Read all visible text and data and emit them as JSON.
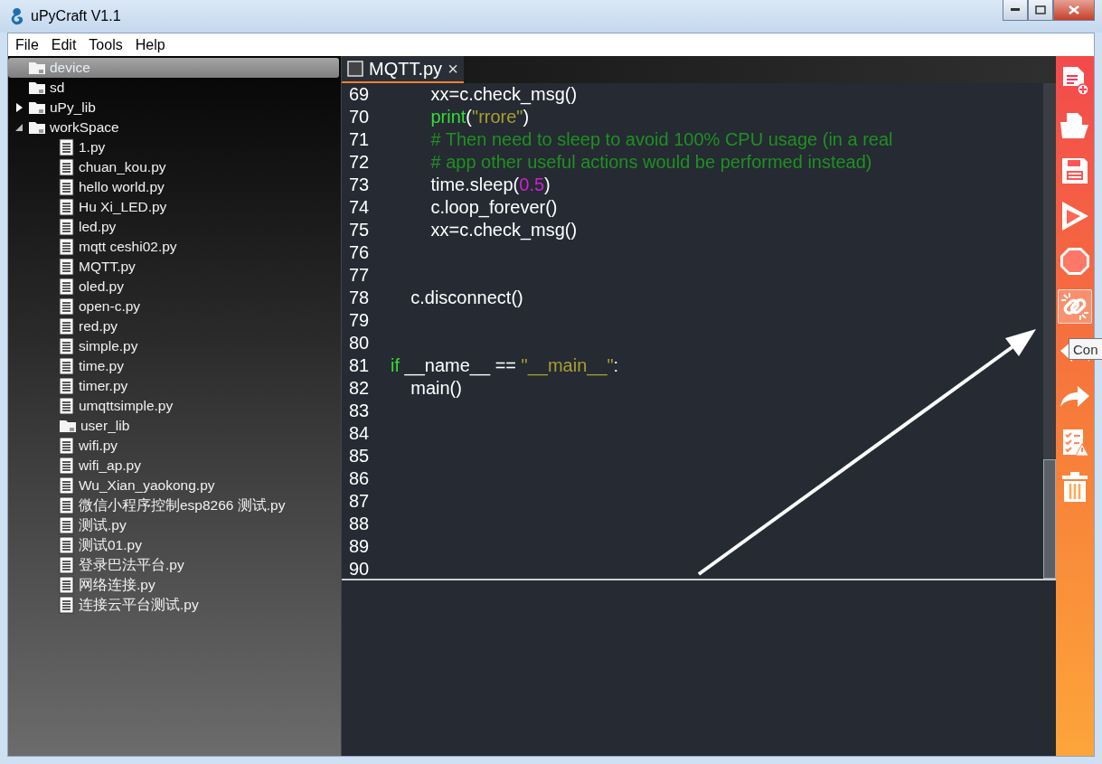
{
  "window": {
    "title": "uPyCraft V1.1"
  },
  "menu": [
    "File",
    "Edit",
    "Tools",
    "Help"
  ],
  "tree": [
    {
      "label": "device",
      "kind": "folder",
      "selected": true
    },
    {
      "label": "sd",
      "kind": "folder",
      "selected": false
    },
    {
      "label": "uPy_lib",
      "kind": "folder",
      "selected": false,
      "expanded": false
    },
    {
      "label": "workSpace",
      "kind": "folder",
      "selected": false,
      "expanded": true,
      "children": [
        {
          "label": "1.py",
          "kind": "file",
          "selected": false
        },
        {
          "label": "chuan_kou.py",
          "kind": "file",
          "selected": false
        },
        {
          "label": "hello world.py",
          "kind": "file",
          "selected": false
        },
        {
          "label": "Hu Xi_LED.py",
          "kind": "file",
          "selected": false
        },
        {
          "label": "led.py",
          "kind": "file",
          "selected": false
        },
        {
          "label": "mqtt ceshi02.py",
          "kind": "file",
          "selected": false
        },
        {
          "label": "MQTT.py",
          "kind": "file",
          "selected": false
        },
        {
          "label": "oled.py",
          "kind": "file",
          "selected": false
        },
        {
          "label": "open-c.py",
          "kind": "file",
          "selected": false
        },
        {
          "label": "red.py",
          "kind": "file",
          "selected": false
        },
        {
          "label": "simple.py",
          "kind": "file",
          "selected": false
        },
        {
          "label": "time.py",
          "kind": "file",
          "selected": false
        },
        {
          "label": "timer.py",
          "kind": "file",
          "selected": false
        },
        {
          "label": "umqttsimple.py",
          "kind": "file",
          "selected": false
        },
        {
          "label": "user_lib",
          "kind": "folder",
          "selected": false
        },
        {
          "label": "wifi.py",
          "kind": "file",
          "selected": false
        },
        {
          "label": "wifi_ap.py",
          "kind": "file",
          "selected": false
        },
        {
          "label": "Wu_Xian_yaokong.py",
          "kind": "file",
          "selected": false
        },
        {
          "label": "微信小程序控制esp8266 测试.py",
          "kind": "file",
          "selected": false
        },
        {
          "label": "测试.py",
          "kind": "file",
          "selected": false
        },
        {
          "label": "测试01.py",
          "kind": "file",
          "selected": false
        },
        {
          "label": "登录巴法平台.py",
          "kind": "file",
          "selected": false
        },
        {
          "label": "网络连接.py",
          "kind": "file",
          "selected": false
        },
        {
          "label": "连接云平台测试.py",
          "kind": "file",
          "selected": false
        }
      ]
    }
  ],
  "tabs": [
    {
      "label": "MQTT.py",
      "selected": true,
      "close": "×"
    }
  ],
  "code": [
    {
      "number": "69",
      "tokens": [
        {
          "kind": "plain",
          "text": "        xx=c.check_msg()"
        }
      ]
    },
    {
      "number": "70",
      "tokens": [
        {
          "kind": "keyword",
          "text": "        print"
        },
        {
          "kind": "plain",
          "text": "("
        },
        {
          "kind": "string",
          "text": "\"rrore\""
        },
        {
          "kind": "plain",
          "text": ")"
        }
      ]
    },
    {
      "number": "71",
      "tokens": [
        {
          "kind": "comment",
          "text": "        # Then need to sleep to avoid 100% CPU usage (in a real"
        }
      ]
    },
    {
      "number": "72",
      "tokens": [
        {
          "kind": "comment",
          "text": "        # app other useful actions would be performed instead)"
        }
      ]
    },
    {
      "number": "73",
      "tokens": [
        {
          "kind": "plain",
          "text": "        time.sleep("
        },
        {
          "kind": "number",
          "text": "0.5"
        },
        {
          "kind": "plain",
          "text": ")"
        }
      ]
    },
    {
      "number": "74",
      "tokens": [
        {
          "kind": "plain",
          "text": "        c.loop_forever()"
        }
      ]
    },
    {
      "number": "75",
      "tokens": [
        {
          "kind": "plain",
          "text": "        xx=c.check_msg()"
        }
      ]
    },
    {
      "number": "76"
    },
    {
      "number": "77"
    },
    {
      "number": "78",
      "tokens": [
        {
          "kind": "plain",
          "text": "    c.disconnect()"
        }
      ]
    },
    {
      "number": "79"
    },
    {
      "number": "80"
    },
    {
      "number": "81",
      "tokens": [
        {
          "kind": "keyword",
          "text": "if"
        },
        {
          "kind": "plain",
          "text": " __name__ == "
        },
        {
          "kind": "string",
          "text": "\"__main__\""
        },
        {
          "kind": "plain",
          "text": ":"
        }
      ]
    },
    {
      "number": "82",
      "tokens": [
        {
          "kind": "plain",
          "text": "    main()"
        }
      ]
    },
    {
      "number": "83"
    },
    {
      "number": "84"
    },
    {
      "number": "85"
    },
    {
      "number": "86"
    },
    {
      "number": "87"
    },
    {
      "number": "88"
    },
    {
      "number": "89"
    },
    {
      "number": "90"
    }
  ],
  "toolbar": [
    {
      "kind": "new",
      "selected": false
    },
    {
      "kind": "open",
      "selected": false
    },
    {
      "kind": "save",
      "selected": false
    },
    {
      "kind": "run",
      "selected": false
    },
    {
      "kind": "stop",
      "selected": false
    },
    {
      "kind": "connect",
      "selected": true
    },
    {
      "kind": "undo",
      "selected": false
    },
    {
      "kind": "redo",
      "selected": false
    },
    {
      "kind": "check",
      "selected": false
    },
    {
      "kind": "clear",
      "selected": false
    }
  ],
  "tooltip": "Con"
}
